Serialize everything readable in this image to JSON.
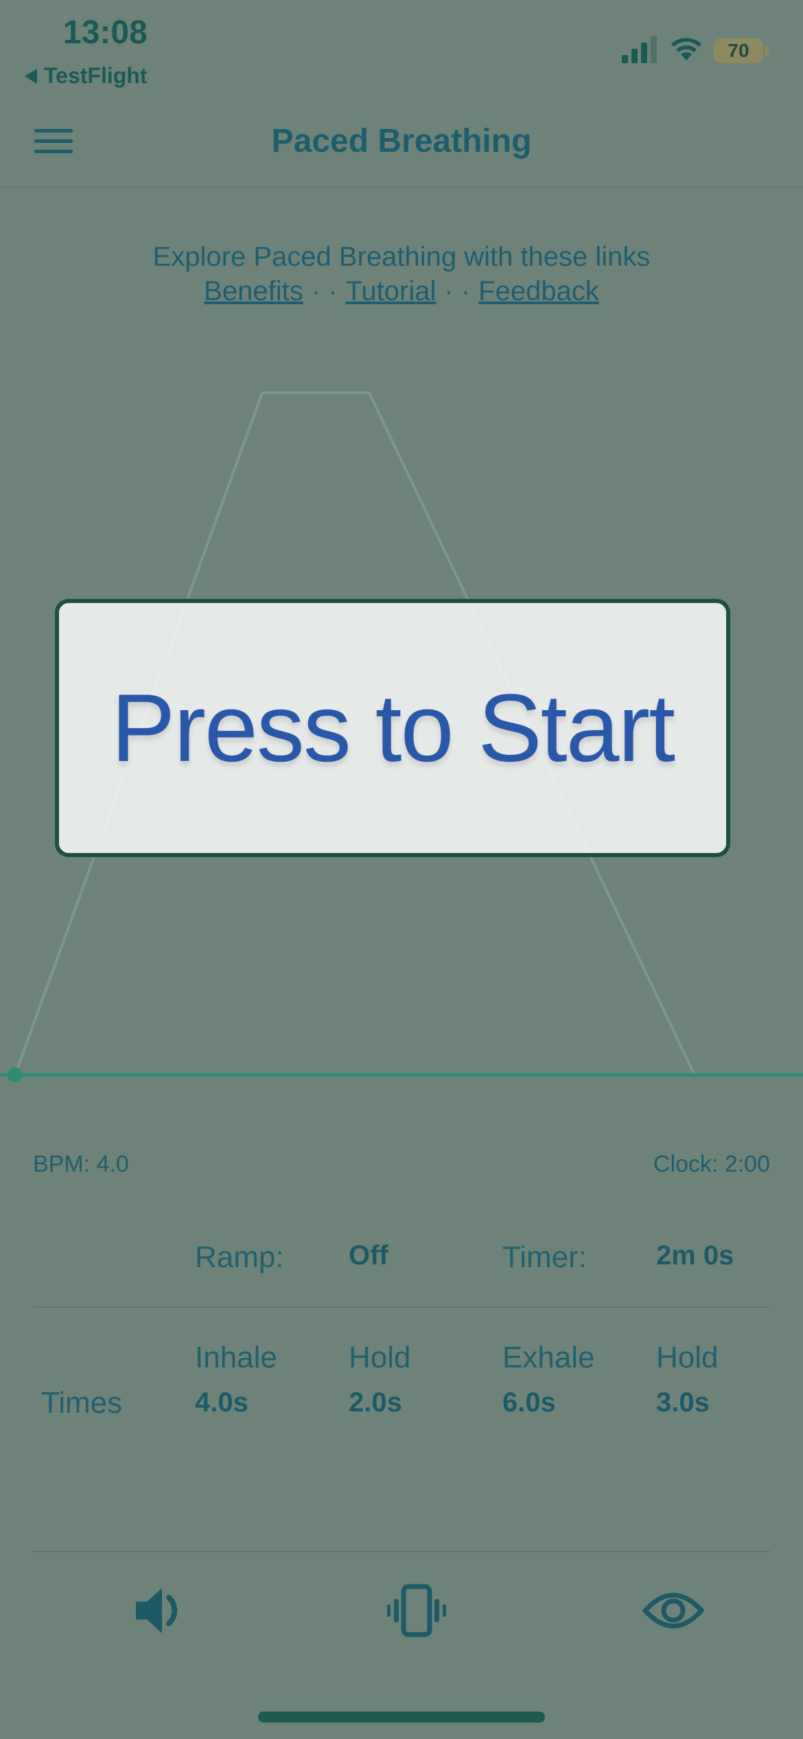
{
  "status_bar": {
    "time": "13:08",
    "back_app": "TestFlight",
    "battery_level": "70",
    "icons": [
      "signal-icon",
      "wifi-icon",
      "battery-icon"
    ]
  },
  "nav": {
    "title": "Paced Breathing",
    "menu_icon": "hamburger-menu-icon"
  },
  "explore": {
    "text": "Explore Paced Breathing with these links",
    "links": [
      {
        "label": "Benefits"
      },
      {
        "label": "Tutorial"
      },
      {
        "label": "Feedback"
      }
    ],
    "separator": "· ·"
  },
  "breath_pattern": {
    "inhale_seconds": 4.0,
    "hold_in_seconds": 2.0,
    "exhale_seconds": 6.0,
    "hold_out_seconds": 3.0
  },
  "start_button": {
    "label": "Press to Start"
  },
  "stats": {
    "bpm": "BPM: 4.0",
    "clock": "Clock: 2:00"
  },
  "settings": {
    "ramp_label": "Ramp:",
    "ramp_value": "Off",
    "timer_label": "Timer:",
    "timer_value": "2m 0s",
    "times_label": "Times",
    "phases": [
      {
        "label": "Inhale",
        "value": "4.0s"
      },
      {
        "label": "Hold",
        "value": "2.0s"
      },
      {
        "label": "Exhale",
        "value": "6.0s"
      },
      {
        "label": "Hold",
        "value": "3.0s"
      }
    ]
  },
  "toolbar": {
    "icons": [
      "speaker-icon",
      "vibrate-icon",
      "eye-icon"
    ]
  },
  "colors": {
    "background": "#6d837a",
    "accent": "#1d5e62",
    "start_text": "#2a58a8",
    "baseline": "#2e8a72"
  }
}
